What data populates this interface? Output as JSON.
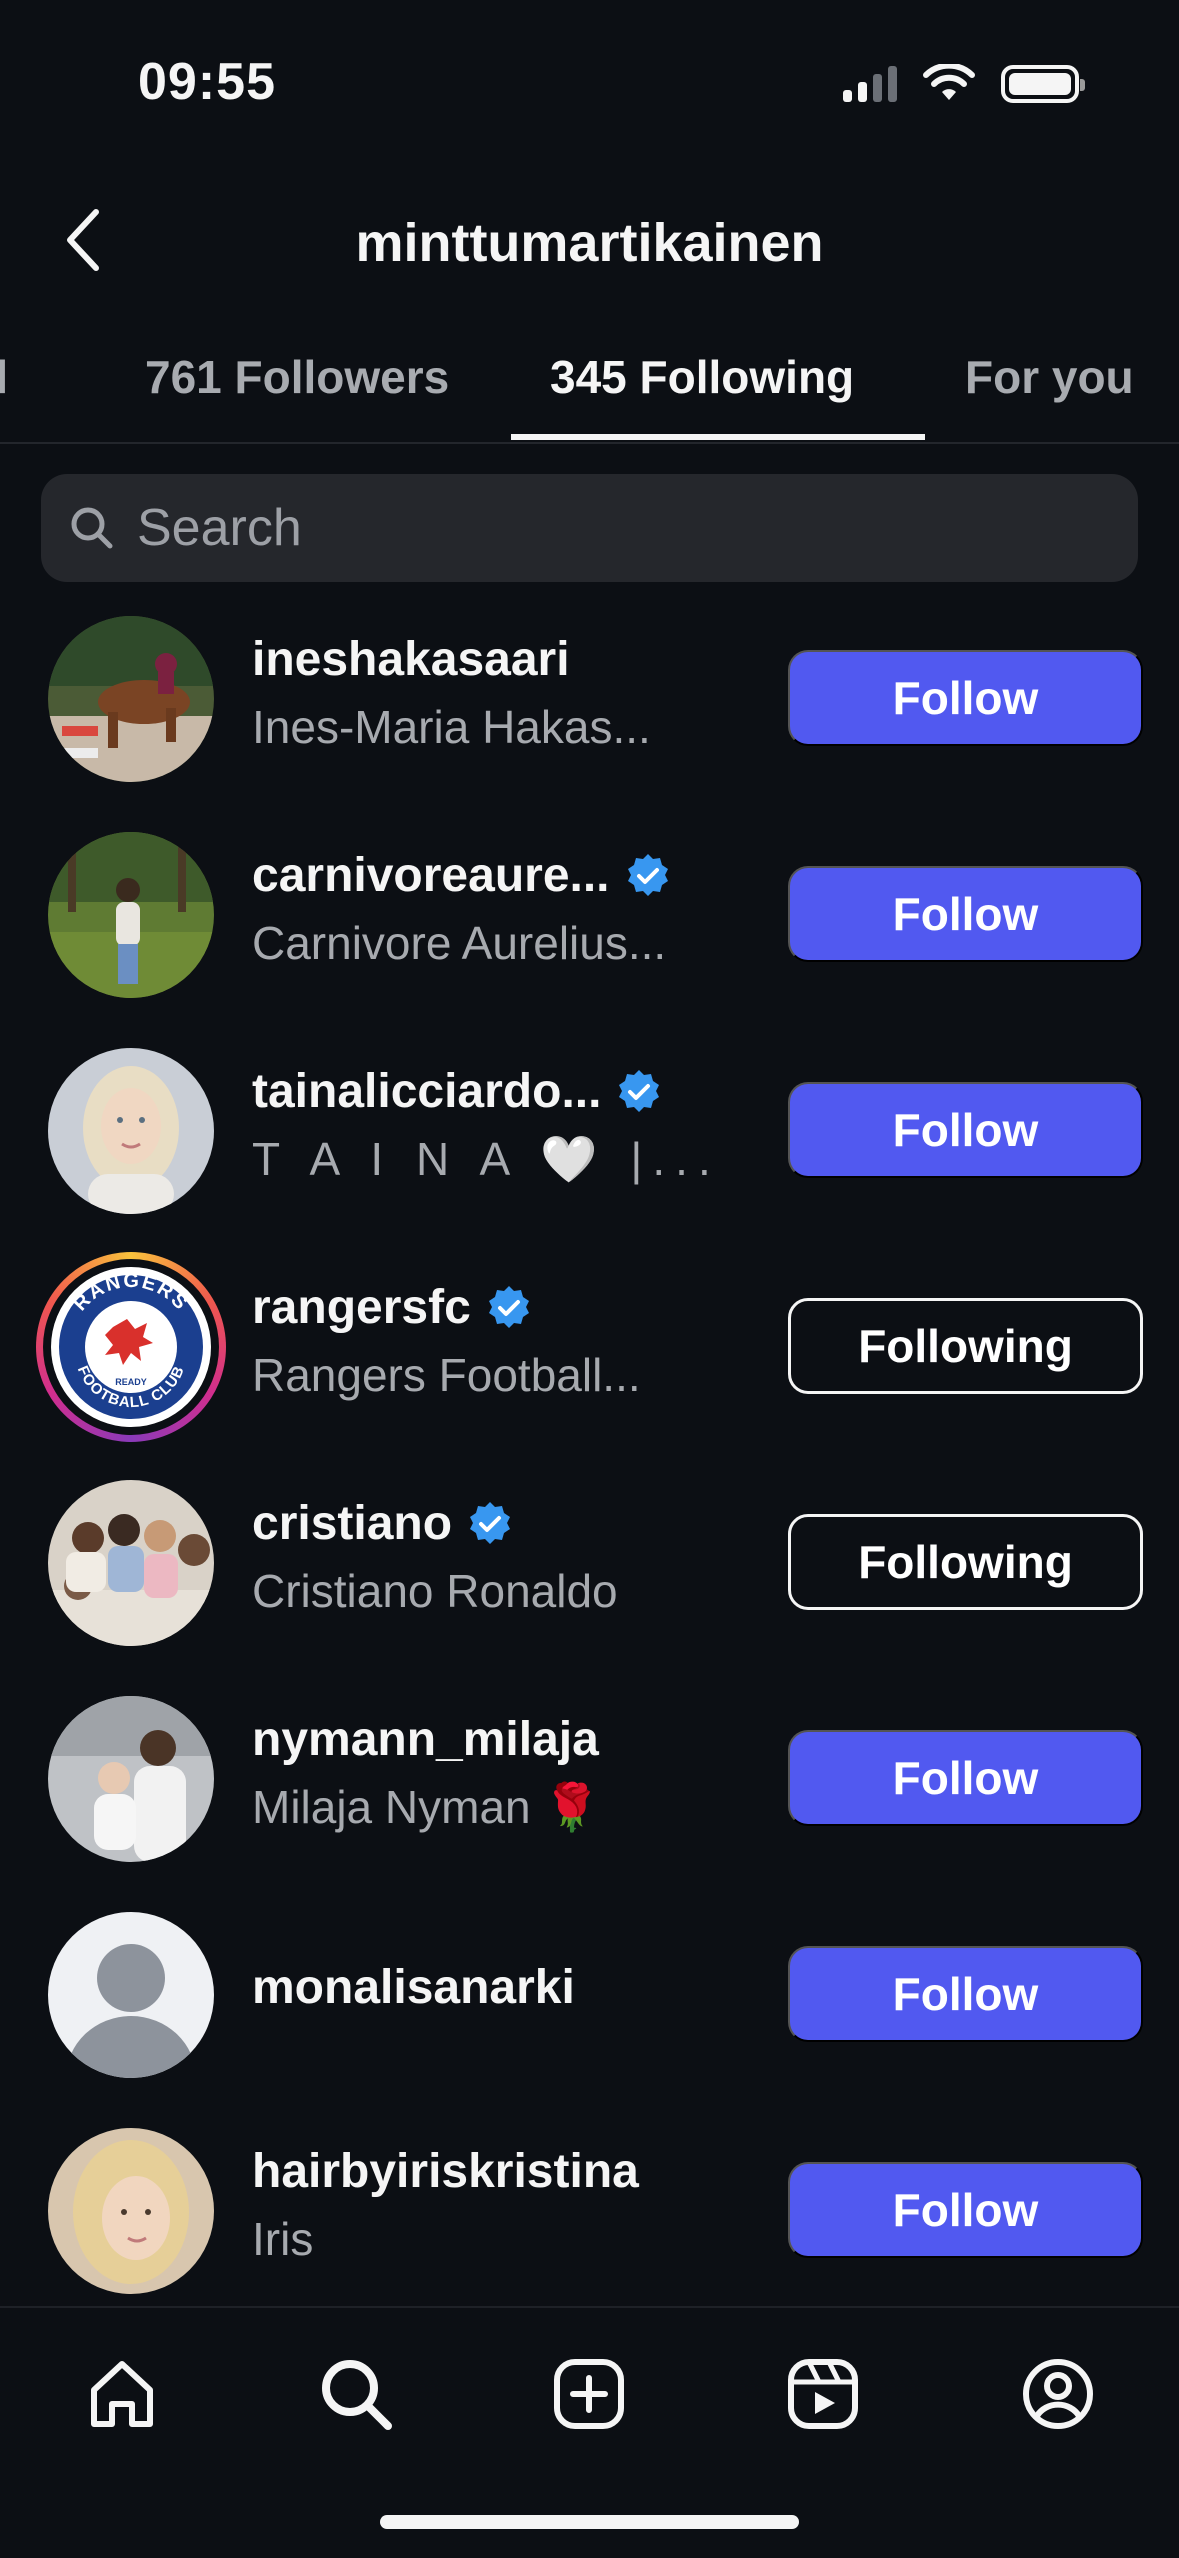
{
  "status_bar": {
    "time": "09:55"
  },
  "header": {
    "title": "minttumartikainen"
  },
  "tabs": [
    {
      "label": "Mutual"
    },
    {
      "label": "761 Followers"
    },
    {
      "label": "345 Following"
    },
    {
      "label": "For you"
    }
  ],
  "search": {
    "placeholder": "Search",
    "value": ""
  },
  "users": [
    {
      "username": "ineshakasaari",
      "full_name": "Ines-Maria Hakas...",
      "verified": false,
      "button": "Follow"
    },
    {
      "username": "carnivoreaure...",
      "full_name": "Carnivore Aurelius...",
      "verified": true,
      "button": "Follow"
    },
    {
      "username": "tainalicciardo...",
      "full_name": "T A I N A 🤍 |...",
      "verified": true,
      "button": "Follow"
    },
    {
      "username": "rangersfc",
      "full_name": "Rangers Football...",
      "verified": true,
      "button": "Following"
    },
    {
      "username": "cristiano",
      "full_name": "Cristiano Ronaldo",
      "verified": true,
      "button": "Following"
    },
    {
      "username": "nymann_milaja",
      "full_name": "Milaja Nyman 🌹",
      "verified": false,
      "button": "Follow"
    },
    {
      "username": "monalisanarki",
      "full_name": "",
      "verified": false,
      "button": "Follow"
    },
    {
      "username": "hairbyiriskristina",
      "full_name": "Iris",
      "verified": false,
      "button": "Follow"
    }
  ],
  "logo_text": {
    "rangers_top": "RANGERS",
    "rangers_bottom": "FOOTBALL CLUB",
    "rangers_ready": "READY"
  },
  "colors": {
    "background": "#0c0f14",
    "accent_blue": "#5159f0",
    "verified_blue": "#3897f0",
    "secondary_text": "#a7aaaf"
  },
  "bottom_nav": [
    {
      "icon": "home-icon"
    },
    {
      "icon": "search-icon"
    },
    {
      "icon": "create-icon"
    },
    {
      "icon": "reels-icon"
    },
    {
      "icon": "profile-icon"
    }
  ]
}
